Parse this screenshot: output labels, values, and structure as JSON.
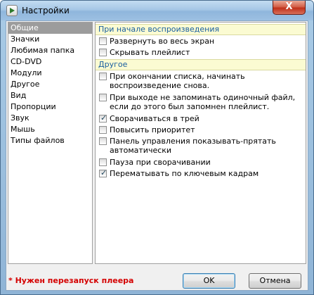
{
  "window": {
    "title": "Настройки",
    "close_symbol": "X"
  },
  "sidebar": {
    "items": [
      {
        "label": "Общие",
        "selected": true
      },
      {
        "label": "Значки"
      },
      {
        "label": "Любимая папка"
      },
      {
        "label": "CD-DVD"
      },
      {
        "label": "Модули"
      },
      {
        "label": "Другое"
      },
      {
        "label": "Вид"
      },
      {
        "label": "Пропорции"
      },
      {
        "label": "Звук"
      },
      {
        "label": "Мышь"
      },
      {
        "label": "Типы файлов"
      }
    ]
  },
  "panel": {
    "groups": [
      {
        "header": "При начале воспроизведения",
        "options": [
          {
            "label": "Развернуть во весь экран",
            "checked": false
          },
          {
            "label": "Скрывать плейлист",
            "checked": false
          }
        ]
      },
      {
        "header": "Другое",
        "options": [
          {
            "label": "При окончании списка, начинать воспроизведение снова.",
            "checked": false
          },
          {
            "label": "При выходе не запоминать одиночный файл, если до этого был запомнен плейлист.",
            "checked": false
          },
          {
            "label": "Сворачиваться в трей",
            "checked": true
          },
          {
            "label": "Повысить приоритет",
            "checked": false
          },
          {
            "label": "Панель управления показывать-прятать автоматически",
            "checked": false
          },
          {
            "label": "Пауза при сворачивании",
            "checked": false
          },
          {
            "label": "Перематывать по ключевым кадрам",
            "checked": true
          }
        ]
      }
    ]
  },
  "footer": {
    "note": "* Нужен перезапуск плеера",
    "ok_label": "OK",
    "cancel_label": "Отмена"
  },
  "colors": {
    "note": "#d40000",
    "group_header_text": "#1a5fa0",
    "group_header_bg": "#fbfbd2",
    "selected_item_bg": "#9c9c9c"
  }
}
